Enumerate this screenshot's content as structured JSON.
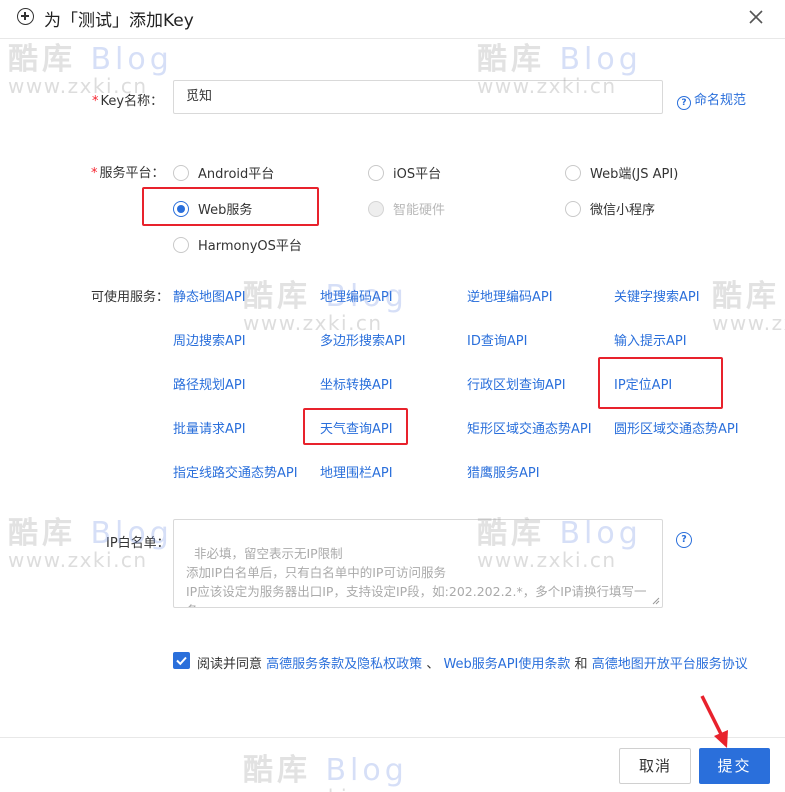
{
  "dialog": {
    "title": "为「测试」添加Key"
  },
  "form": {
    "key_name": {
      "label": "Key名称：",
      "value": "觅知",
      "help_link": "命名规范"
    },
    "platform": {
      "label": "服务平台：",
      "options": [
        {
          "label": "Android平台",
          "state": "unchecked"
        },
        {
          "label": "iOS平台",
          "state": "unchecked"
        },
        {
          "label": "Web端(JS API)",
          "state": "unchecked"
        },
        {
          "label": "Web服务",
          "state": "checked"
        },
        {
          "label": "智能硬件",
          "state": "disabled"
        },
        {
          "label": "微信小程序",
          "state": "unchecked"
        },
        {
          "label": "HarmonyOS平台",
          "state": "unchecked"
        }
      ]
    },
    "services": {
      "label": "可使用服务：",
      "items": [
        "静态地图API",
        "地理编码API",
        "逆地理编码API",
        "关键字搜索API",
        "周边搜索API",
        "多边形搜索API",
        "ID查询API",
        "输入提示API",
        "路径规划API",
        "坐标转换API",
        "行政区划查询API",
        "IP定位API",
        "批量请求API",
        "天气查询API",
        "矩形区域交通态势API",
        "圆形区域交通态势API",
        "指定线路交通态势API",
        "地理围栏API",
        "猎鹰服务API"
      ]
    },
    "ip_whitelist": {
      "label": "IP白名单：",
      "placeholder": "非必填，留空表示无IP限制\n添加IP白名单后，只有白名单中的IP可访问服务\nIP应该设定为服务器出口IP，支持设定IP段，如:202.202.2.*，多个IP请换行填写一条"
    },
    "agreement": {
      "checked": true,
      "prefix": "阅读并同意",
      "link1": "高德服务条款及隐私权政策",
      "sep1": "、",
      "link2": "Web服务API使用条款",
      "sep2": "和",
      "link3": "高德地图开放平台服务协议"
    }
  },
  "footer": {
    "cancel": "取消",
    "submit": "提交"
  },
  "watermark": {
    "brand": "酷库",
    "blog": "Blog",
    "url": "www.zxki.cn"
  },
  "colors": {
    "accent": "#2a6fdb",
    "highlight_box": "#e8222c",
    "required": "#f5222d"
  }
}
